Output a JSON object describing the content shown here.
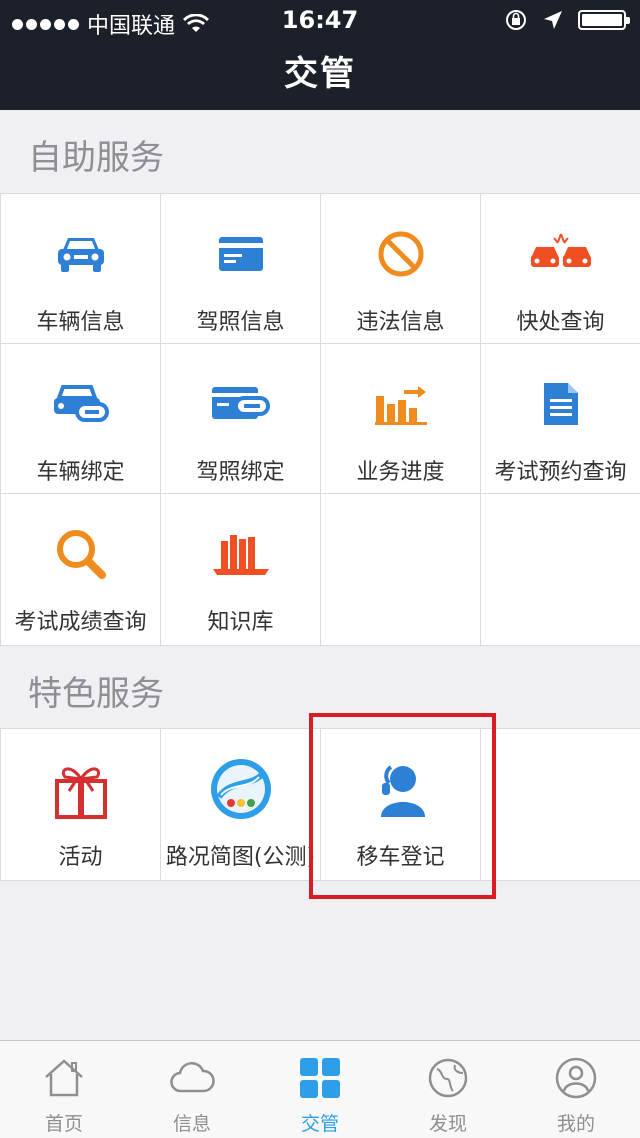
{
  "status_bar": {
    "carrier": "中国联通",
    "time": "16:47"
  },
  "header": {
    "title": "交管"
  },
  "self_service": {
    "title": "自助服务",
    "items": [
      {
        "label": "车辆信息",
        "icon": "car-icon"
      },
      {
        "label": "驾照信息",
        "icon": "license-card-icon"
      },
      {
        "label": "违法信息",
        "icon": "prohibited-icon"
      },
      {
        "label": "快处查询",
        "icon": "car-accident-icon"
      },
      {
        "label": "车辆绑定",
        "icon": "car-link-icon"
      },
      {
        "label": "驾照绑定",
        "icon": "license-link-icon"
      },
      {
        "label": "业务进度",
        "icon": "progress-chart-icon"
      },
      {
        "label": "考试预约查询",
        "icon": "document-icon"
      },
      {
        "label": "考试成绩查询",
        "icon": "magnifier-icon"
      },
      {
        "label": "知识库",
        "icon": "books-icon"
      }
    ]
  },
  "featured_service": {
    "title": "特色服务",
    "items": [
      {
        "label": "活动",
        "icon": "gift-icon"
      },
      {
        "label": "路况简图(公测)",
        "icon": "road-map-icon"
      },
      {
        "label": "移车登记",
        "icon": "operator-icon"
      }
    ]
  },
  "tabbar": {
    "items": [
      {
        "label": "首页",
        "icon": "home-icon"
      },
      {
        "label": "信息",
        "icon": "cloud-icon"
      },
      {
        "label": "交管",
        "icon": "grid-icon"
      },
      {
        "label": "发现",
        "icon": "globe-icon"
      },
      {
        "label": "我的",
        "icon": "user-icon"
      }
    ]
  },
  "colors": {
    "header_bg": "#1c2129",
    "accent_blue": "#2e9ee8",
    "accent_orange": "#f08c1e",
    "highlight_red": "#d81e22"
  }
}
